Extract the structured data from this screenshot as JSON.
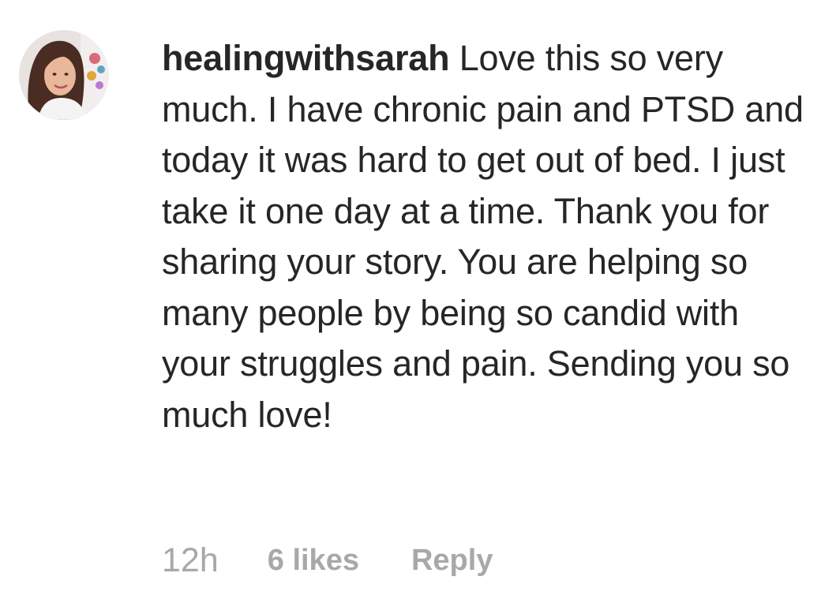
{
  "comment": {
    "username": "healingwithsarah",
    "text": "Love this so very much. I have chronic pain and PTSD and today it was hard to get out of bed. I just take it one day at a time. Thank you for sharing your story. You are helping so many people by being so candid with your struggles and pain. Sending you so much love!",
    "timestamp": "12h",
    "likes": "6 likes",
    "reply_label": "Reply"
  },
  "colors": {
    "text": "#262626",
    "meta": "#a8a8a8",
    "background": "#ffffff"
  }
}
